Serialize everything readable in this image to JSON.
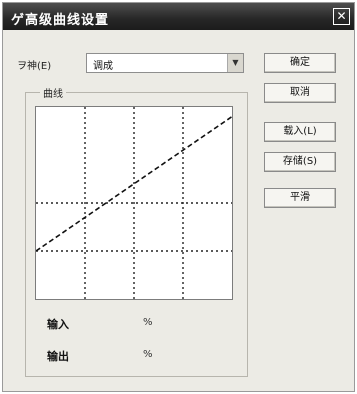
{
  "dialog": {
    "title": "ゲ高级曲线设置",
    "close_label": "✕"
  },
  "mode": {
    "label": "ヲ神(E)",
    "selected": "调成"
  },
  "group": {
    "label": "曲线"
  },
  "graph": {
    "curve_start_pct": 25,
    "curve_end_pct": 95
  },
  "readout": {
    "input_label": "输入",
    "input_value": "%",
    "output_label": "输出",
    "output_value": "%"
  },
  "buttons": {
    "ok": "确定",
    "cancel": "取消",
    "load": "载入(L)",
    "save": "存储(S)",
    "smooth": "平滑"
  }
}
